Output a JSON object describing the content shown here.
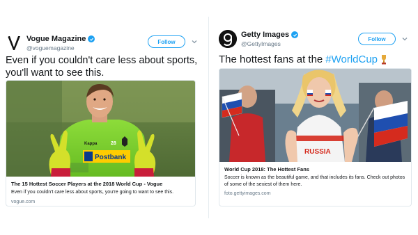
{
  "left_tweet": {
    "name": "Vogue Magazine",
    "handle": "@voguemagazine",
    "follow_label": "Follow",
    "text": "Even if you couldn't care less about sports, you'll want to see this.",
    "card": {
      "title": "The 15 Hottest Soccer Players at the 2018 World Cup - Vogue",
      "description": "Even if you couldn't care less about sports, you're going to want to see this.",
      "domain": "vogue.com",
      "image_brand_top": "Kappa",
      "image_number": "28",
      "image_sponsor": "Postbank"
    }
  },
  "right_tweet": {
    "name": "Getty Images",
    "handle": "@GettyImages",
    "follow_label": "Follow",
    "text_plain": "The hottest fans at the",
    "hashtag": "#WorldCup",
    "card": {
      "title": "World Cup 2018: The Hottest Fans",
      "description": "Soccer is known as the beautiful game, and that includes its fans. Check out photos of some of the sexiest of them here.",
      "domain": "foto.gettyimages.com",
      "image_shirt_text": "RUSSIA"
    }
  },
  "colors": {
    "accent": "#1da1f2",
    "text": "#14171a",
    "muted": "#657786",
    "border": "#e1e8ed"
  }
}
